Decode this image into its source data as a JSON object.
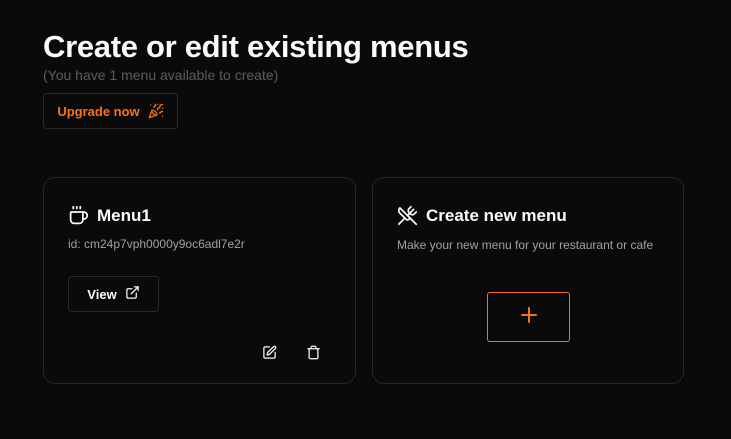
{
  "header": {
    "title": "Create or edit existing menus",
    "subtitle": "(You have 1 menu available to create)",
    "upgrade_label": "Upgrade now",
    "upgrade_icon": "party-popper-icon"
  },
  "menu_card": {
    "icon": "coffee-cup-icon",
    "title": "Menu1",
    "id_text": "id: cm24p7vph0000y9oc6adl7e2r",
    "view_label": "View",
    "view_icon": "external-link-icon",
    "edit_icon": "edit-icon",
    "delete_icon": "trash-icon"
  },
  "new_card": {
    "icon": "utensils-crossed-icon",
    "title": "Create new menu",
    "description": "Make your new menu for your restaurant or cafe",
    "add_icon": "plus-icon"
  },
  "colors": {
    "background": "#0a0a0a",
    "accent": "#f97316",
    "border": "#262626",
    "muted_text": "#a1a1a1",
    "subtitle_text": "#5c5c5c"
  }
}
